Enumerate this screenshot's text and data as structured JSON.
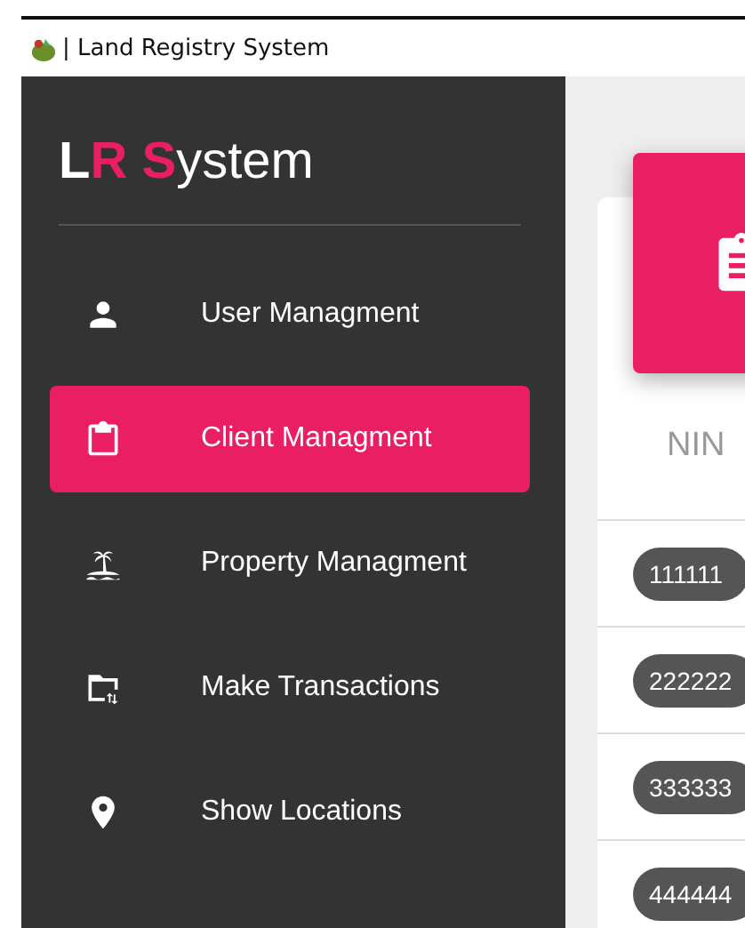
{
  "window": {
    "title": "| Land Registry System"
  },
  "sidebar": {
    "logo": [
      {
        "text": "L",
        "kind": "bold"
      },
      {
        "text": "R",
        "kind": "accent"
      },
      {
        "text": " S",
        "kind": "accent"
      },
      {
        "text": "ystem",
        "kind": "light"
      }
    ],
    "items": [
      {
        "label": "User Managment",
        "selected": false
      },
      {
        "label": "Client Managment",
        "selected": true
      },
      {
        "label": "Property Managment",
        "selected": false
      },
      {
        "label": "Make Transactions",
        "selected": false
      },
      {
        "label": "Show Locations",
        "selected": false
      }
    ]
  },
  "table": {
    "columns": [
      "NIN"
    ],
    "rows": [
      {
        "nin": "111111"
      },
      {
        "nin": "222222"
      },
      {
        "nin": "333333"
      },
      {
        "nin": "444444"
      }
    ]
  }
}
